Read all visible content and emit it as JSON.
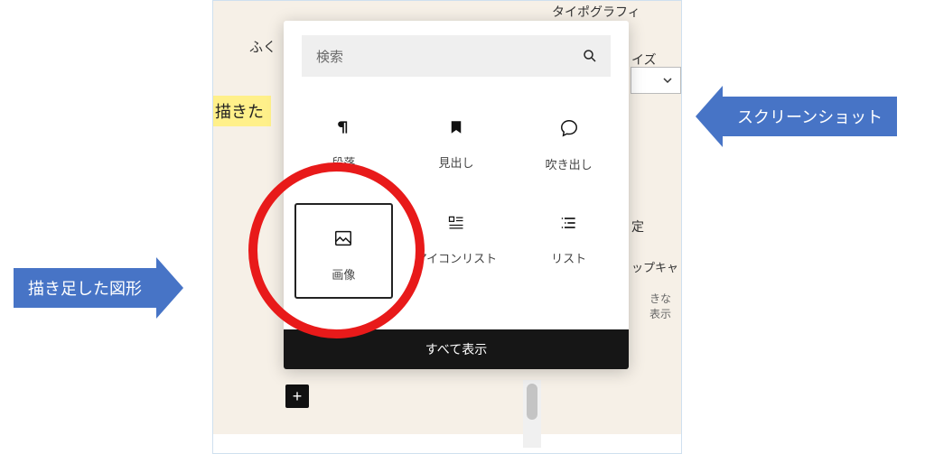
{
  "background": {
    "fuku_text": "ふく",
    "highlight_text": "描きた"
  },
  "popover": {
    "search_placeholder": "検索",
    "blocks": [
      {
        "id": "paragraph",
        "label": "段落",
        "icon": "pilcrow"
      },
      {
        "id": "heading",
        "label": "見出し",
        "icon": "bookmark"
      },
      {
        "id": "balloon",
        "label": "吹き出し",
        "icon": "speech"
      },
      {
        "id": "image",
        "label": "画像",
        "icon": "image",
        "selected": true
      },
      {
        "id": "iconlist",
        "label": "アイコンリスト",
        "icon": "iconlist"
      },
      {
        "id": "list",
        "label": "リスト",
        "icon": "list"
      }
    ],
    "showall_label": "すべて表示"
  },
  "sidebar": {
    "typography_label": "タイポグラフィ",
    "size_suffix": "イズ",
    "settings_suffix": "定",
    "dropcap_suffix": "ップキャ",
    "bigdisplay_suffix": "きな表示"
  },
  "annotations": {
    "left_label": "描き足した図形",
    "right_label": "スクリーンショット"
  },
  "colors": {
    "arrow_fill": "#4774c6",
    "circle_stroke": "#e81a1a"
  }
}
